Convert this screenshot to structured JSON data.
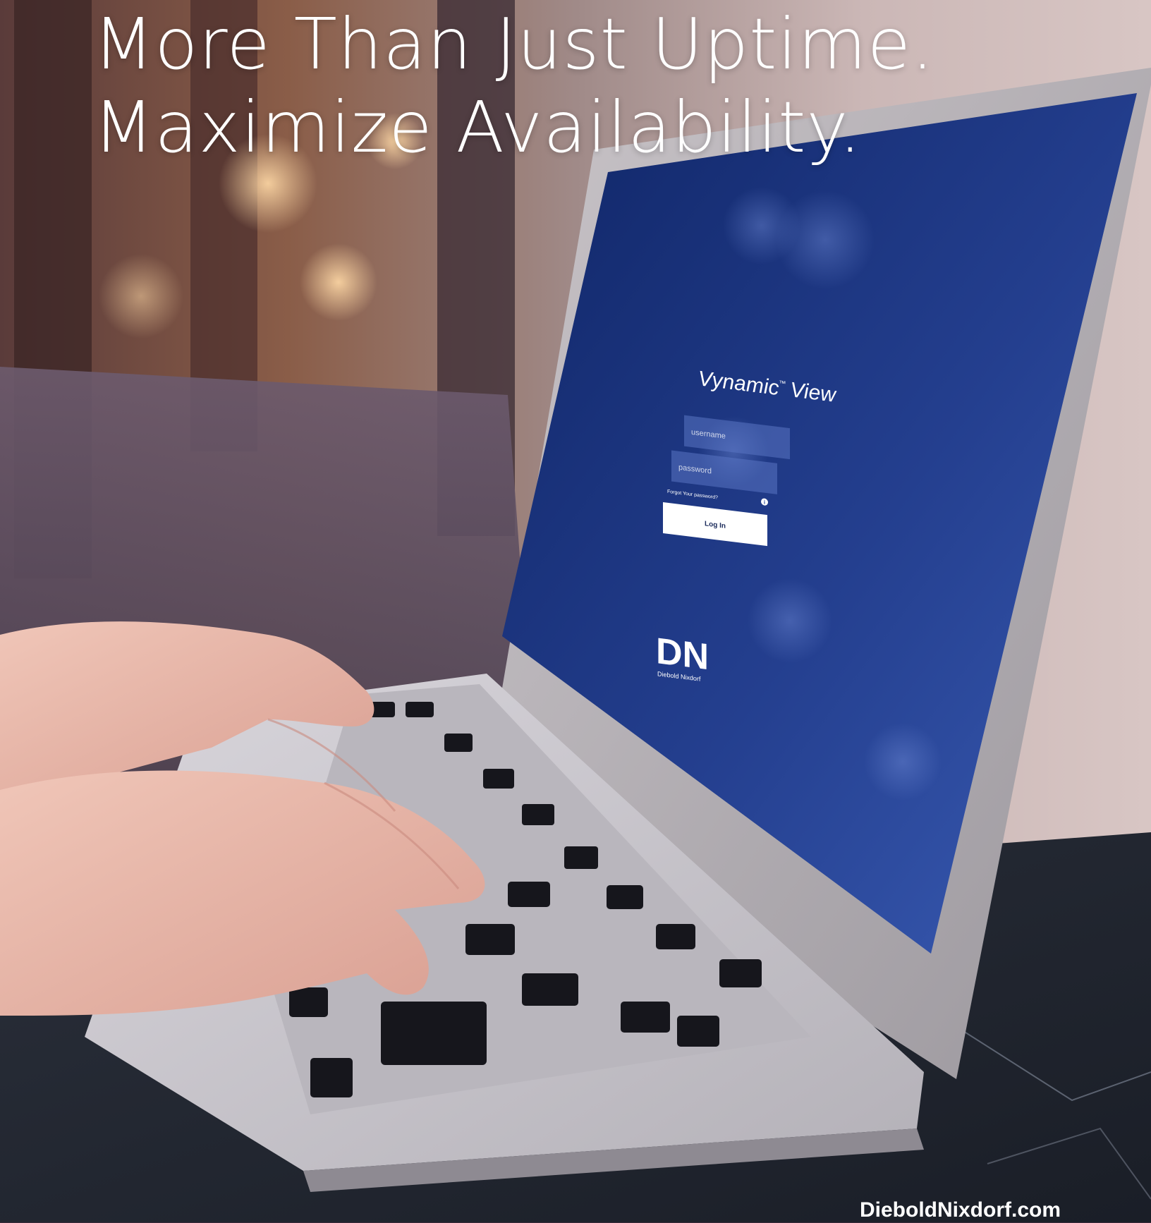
{
  "headline": {
    "line1": "More Than Just Uptime.",
    "line2": "Maximize Availability."
  },
  "footer": {
    "url": "DieboldNixdorf.com"
  },
  "login_screen": {
    "app_name": "Vynamic",
    "trademark": "™",
    "app_suffix": "View",
    "username_placeholder": "username",
    "password_placeholder": "password",
    "forgot_link": "Forgot Your password?",
    "login_button": "Log In",
    "info_icon": "info-icon"
  },
  "brand": {
    "monogram": "DN",
    "name": "Diebold Nixdorf"
  },
  "colors": {
    "screen_blue": "#2c4a9a",
    "screen_dark": "#0f2566",
    "headline": "#ffffff",
    "button_bg": "#ffffff"
  }
}
